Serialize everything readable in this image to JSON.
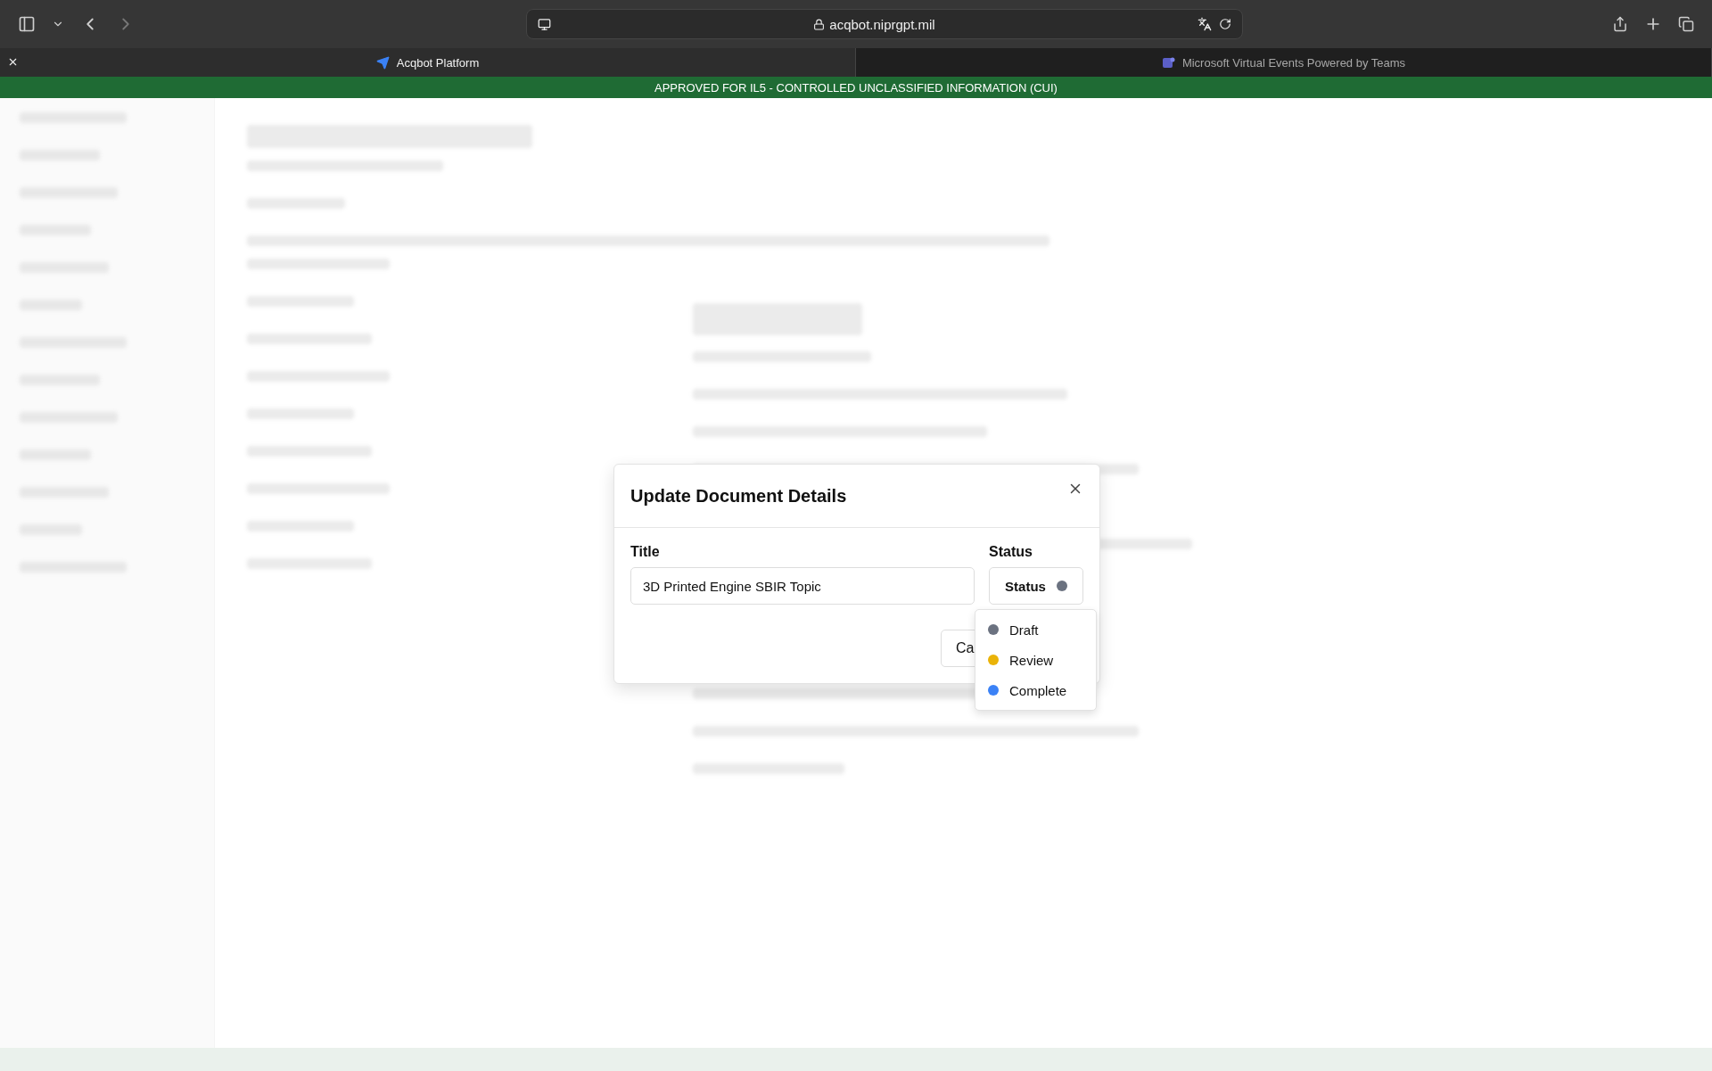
{
  "browser": {
    "url": "acqbot.niprgpt.mil",
    "tabs": [
      {
        "label": "Acqbot Platform",
        "selected": true
      },
      {
        "label": "Microsoft Virtual Events Powered by Teams",
        "selected": false
      }
    ]
  },
  "banner": {
    "text": "APPROVED FOR IL5 - CONTROLLED UNCLASSIFIED INFORMATION (CUI)"
  },
  "dialog": {
    "title": "Update Document Details",
    "title_label": "Title",
    "title_value": "3D Printed Engine SBIR Topic",
    "status_label": "Status",
    "status_button": {
      "label": "Status",
      "color": "#6b7280"
    },
    "cancel_button": "Ca",
    "status_options": [
      {
        "label": "Draft",
        "color": "#6b7280"
      },
      {
        "label": "Review",
        "color": "#eab308"
      },
      {
        "label": "Complete",
        "color": "#3b82f6"
      }
    ]
  }
}
